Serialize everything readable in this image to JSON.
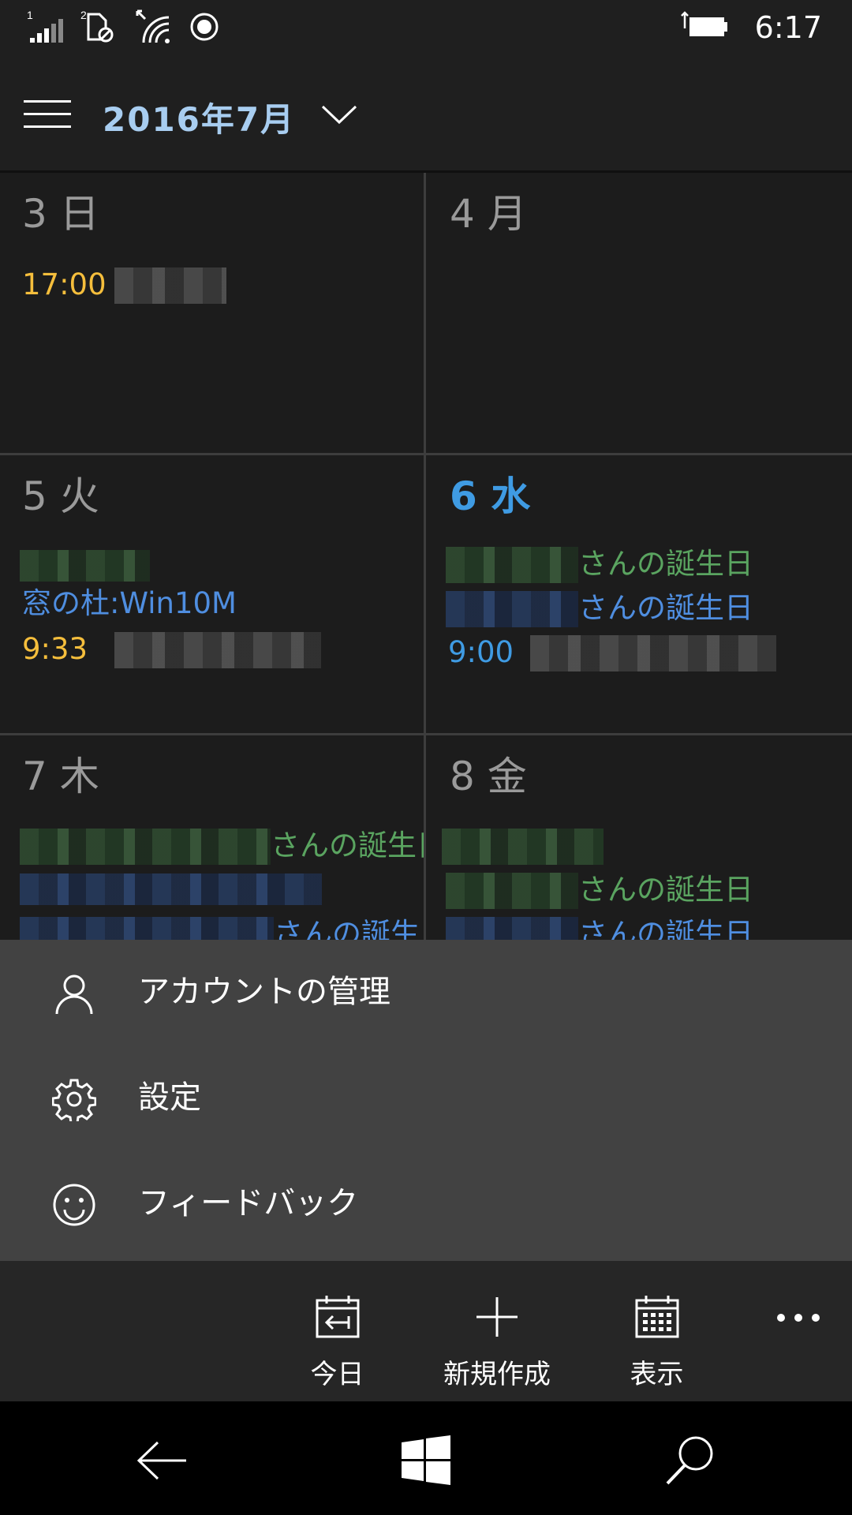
{
  "status_bar": {
    "time": "6:17",
    "sim1_label": "1",
    "sim2_label": "2",
    "icons": [
      "signal-icon",
      "sim2-no-data-icon",
      "wifi-icon",
      "location-icon",
      "battery-charging-icon"
    ]
  },
  "header": {
    "title": "2016年7月"
  },
  "calendar": {
    "cells": [
      {
        "day": "3 日",
        "events": [
          {
            "time": "17:00"
          }
        ]
      },
      {
        "day": "4 月",
        "events": []
      },
      {
        "day": "5 火",
        "events": [
          {
            "title": "窓の杜:Win10M"
          },
          {
            "time": "9:33"
          }
        ]
      },
      {
        "day": "6 水",
        "events": [
          {
            "title": "さんの誕生日"
          },
          {
            "title": "さんの誕生日"
          },
          {
            "time": "9:00"
          }
        ]
      },
      {
        "day": "7 木",
        "events": [
          {
            "title": "さんの誕生日"
          },
          {
            "title": "さんの誕生日"
          }
        ]
      },
      {
        "day": "8 金",
        "events": [
          {
            "title": "さんの誕生日"
          },
          {
            "title": "さんの誕生日"
          }
        ]
      }
    ]
  },
  "menu": {
    "items": [
      {
        "label": "アカウントの管理",
        "icon": "person-icon"
      },
      {
        "label": "設定",
        "icon": "gear-icon"
      },
      {
        "label": "フィードバック",
        "icon": "smiley-icon"
      }
    ]
  },
  "app_bar": {
    "buttons": [
      {
        "label": "今日",
        "icon": "calendar-today-icon"
      },
      {
        "label": "新規作成",
        "icon": "plus-icon"
      },
      {
        "label": "表示",
        "icon": "calendar-view-icon"
      }
    ],
    "more": "more-icon"
  },
  "nav_bar": {
    "buttons": [
      "back-arrow-icon",
      "windows-logo-icon",
      "search-icon"
    ]
  },
  "colors": {
    "accent": "#3f9be3",
    "today": "#3f9be3",
    "event_orange": "#f5be3c",
    "event_green": "#5aa460",
    "event_blue": "#4f8ee0",
    "menu_bg": "#424242",
    "app_bar_bg": "#262626"
  }
}
